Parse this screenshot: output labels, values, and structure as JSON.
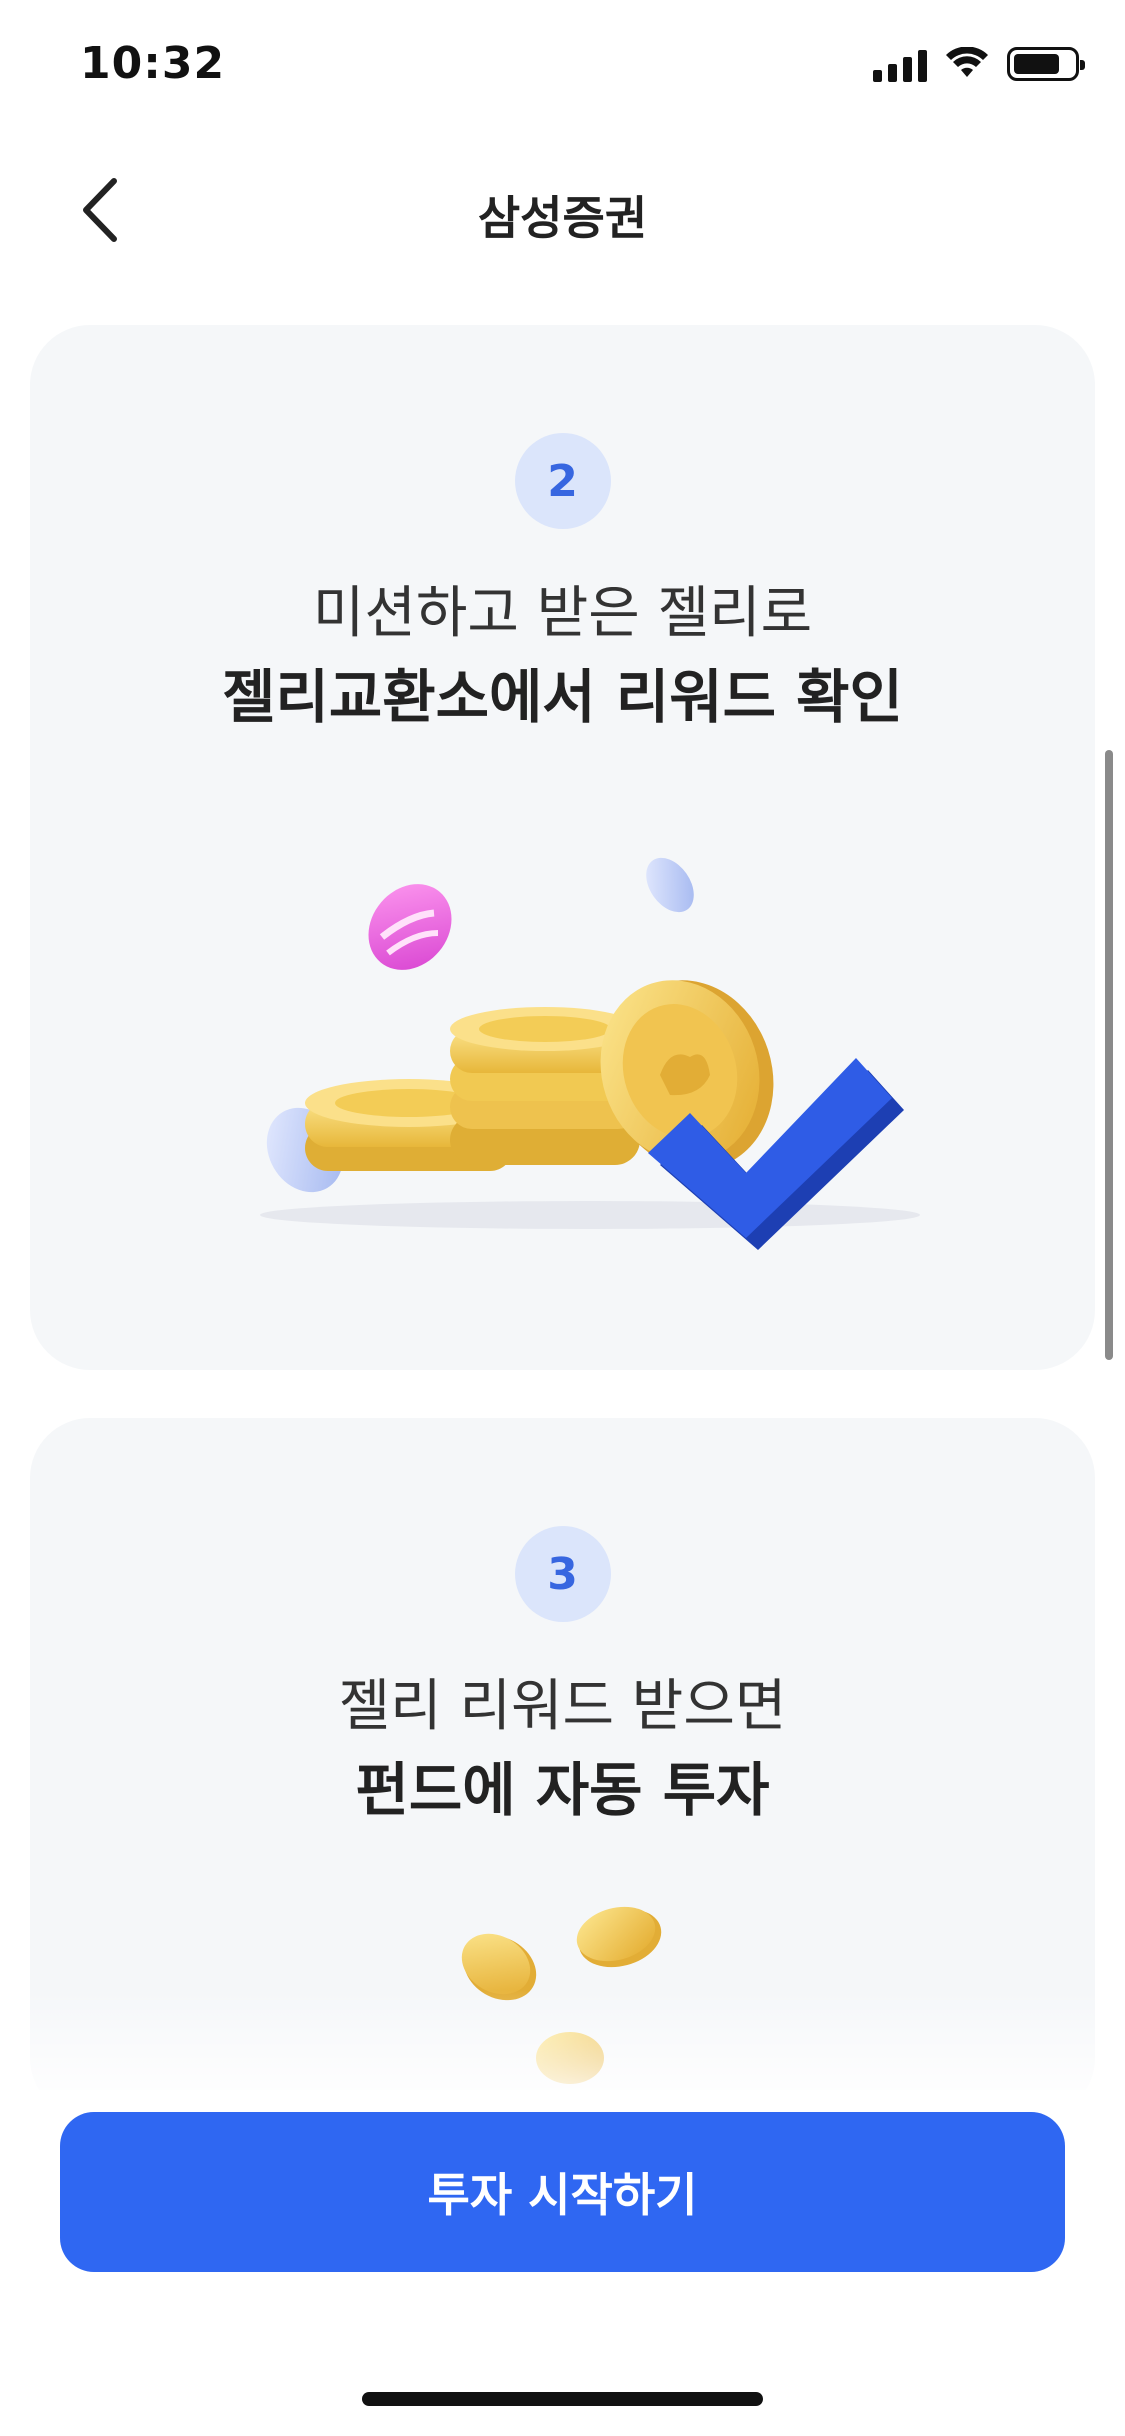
{
  "status_bar": {
    "time": "10:32"
  },
  "header": {
    "title": "삼성증권"
  },
  "cards": [
    {
      "step": "2",
      "line1": "미션하고 받은 젤리로",
      "line2": "젤리교환소에서 리워드 확인"
    },
    {
      "step": "3",
      "line1": "젤리 리워드 받으면",
      "line2": "펀드에 자동 투자"
    }
  ],
  "cta": {
    "label": "투자 시작하기"
  },
  "colors": {
    "accent": "#2f67f2",
    "badge_bg": "#dbe5fb",
    "badge_text": "#3766e0",
    "card_bg": "#f5f7f9"
  }
}
